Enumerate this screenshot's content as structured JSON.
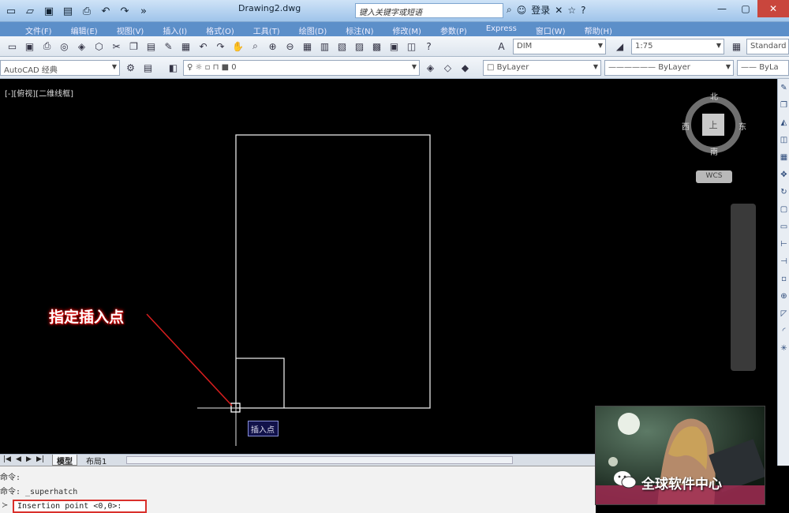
{
  "window": {
    "title": "Drawing2.dwg",
    "search_placeholder": "键入关键字或短语",
    "login_label": "登录",
    "help_label": "?"
  },
  "menu": [
    "文件(F)",
    "编辑(E)",
    "视图(V)",
    "插入(I)",
    "格式(O)",
    "工具(T)",
    "绘图(D)",
    "标注(N)",
    "修改(M)",
    "参数(P)",
    "Express",
    "窗口(W)",
    "帮助(H)"
  ],
  "toolbar": {
    "dim_style": "DIM",
    "scale": "1:75",
    "text_style": "Standard",
    "workspace": "AutoCAD 经典",
    "layer": "0",
    "color": "ByLayer",
    "linetype": "ByLayer",
    "lineweight": "ByLa"
  },
  "canvas": {
    "viewport_label": "[-][俯视][二维线框]",
    "viewcube": {
      "north": "北",
      "south": "南",
      "east": "东",
      "west": "西",
      "face": "上",
      "wcs": "WCS"
    },
    "annotation": "指定插入点",
    "tooltip": "插入点"
  },
  "layout_tabs": {
    "model": "模型",
    "layout1": "布局1"
  },
  "command": {
    "line1": "命令:",
    "line2": "命令: _superhatch",
    "input": "Insertion point <0,0>:"
  },
  "overlay": {
    "label": "全球软件中心"
  }
}
